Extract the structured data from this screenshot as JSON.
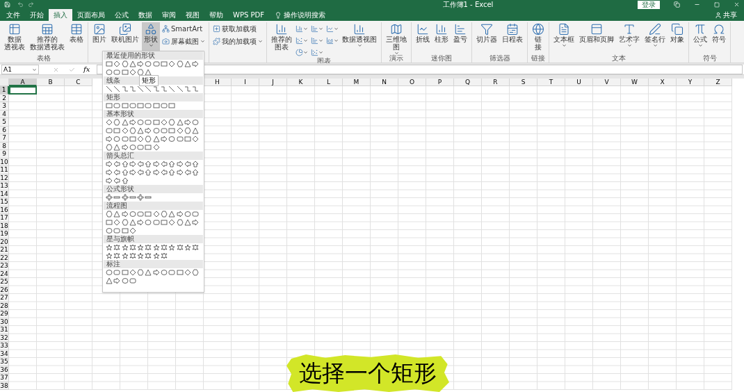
{
  "window": {
    "title": "工作簿1 - Excel",
    "login": "登录"
  },
  "tabs": [
    {
      "label": "文件",
      "selected": false
    },
    {
      "label": "开始",
      "selected": false
    },
    {
      "label": "插入",
      "selected": true
    },
    {
      "label": "页面布局",
      "selected": false
    },
    {
      "label": "公式",
      "selected": false
    },
    {
      "label": "数据",
      "selected": false
    },
    {
      "label": "审阅",
      "selected": false
    },
    {
      "label": "视图",
      "selected": false
    },
    {
      "label": "帮助",
      "selected": false
    },
    {
      "label": "WPS PDF",
      "selected": false
    }
  ],
  "tell_me": "操作说明搜索",
  "share": "共享",
  "ribbon_groups": [
    {
      "label": "表格",
      "items": [
        {
          "kind": "large",
          "lines": [
            "数据",
            "透视表"
          ],
          "selected": false,
          "has_menu": false
        },
        {
          "kind": "large",
          "lines": [
            "推荐的",
            "数据透视表"
          ],
          "selected": false,
          "has_menu": false
        },
        {
          "kind": "large",
          "lines": [
            "表格"
          ],
          "selected": false,
          "has_menu": false
        }
      ]
    },
    {
      "items": [
        {
          "kind": "large",
          "lines": [
            "图片"
          ],
          "selected": false,
          "has_menu": false
        },
        {
          "kind": "large",
          "lines": [
            "联机图片"
          ],
          "selected": false,
          "has_menu": false
        },
        {
          "kind": "large",
          "lines": [
            "形状"
          ],
          "selected": true,
          "has_menu": true
        },
        {
          "kind": "small",
          "lines": [
            "SmartArt"
          ],
          "selected": false,
          "has_menu": false
        },
        {
          "kind": "small",
          "lines": [
            "屏幕截图"
          ],
          "selected": false,
          "has_menu": true
        }
      ]
    },
    {
      "items": [
        {
          "kind": "small",
          "lines": [
            "获取加载项"
          ],
          "selected": false,
          "has_menu": false
        },
        {
          "kind": "small",
          "lines": [
            "我的加载项"
          ],
          "selected": false,
          "has_menu": true
        }
      ]
    },
    {
      "label": "图表",
      "items": [
        {
          "kind": "large",
          "lines": [
            "推荐的",
            "图表"
          ],
          "selected": false,
          "has_menu": false
        },
        {
          "kind": "icon",
          "selected": false,
          "has_menu": true
        },
        {
          "kind": "icon",
          "selected": false,
          "has_menu": true
        },
        {
          "kind": "icon",
          "selected": false,
          "has_menu": true
        },
        {
          "kind": "icon",
          "selected": false,
          "has_menu": true
        },
        {
          "kind": "icon",
          "selected": false,
          "has_menu": true
        },
        {
          "kind": "icon",
          "selected": false,
          "has_menu": true
        },
        {
          "kind": "icon",
          "selected": false,
          "has_menu": true
        },
        {
          "kind": "icon",
          "selected": false,
          "has_menu": true
        },
        {
          "kind": "large",
          "lines": [
            "数据透视图"
          ],
          "selected": false,
          "has_menu": true
        }
      ]
    },
    {
      "label": "演示",
      "items": [
        {
          "kind": "large",
          "lines": [
            "三维地",
            "图"
          ],
          "selected": false,
          "has_menu": true
        }
      ]
    },
    {
      "label": "迷你图",
      "items": [
        {
          "kind": "large",
          "lines": [
            "折线"
          ],
          "selected": false,
          "has_menu": false
        },
        {
          "kind": "large",
          "lines": [
            "柱形"
          ],
          "selected": false,
          "has_menu": false
        },
        {
          "kind": "large",
          "lines": [
            "盈亏"
          ],
          "selected": false,
          "has_menu": false
        }
      ]
    },
    {
      "label": "筛选器",
      "items": [
        {
          "kind": "large",
          "lines": [
            "切片器"
          ],
          "selected": false,
          "has_menu": false
        },
        {
          "kind": "large",
          "lines": [
            "日程表"
          ],
          "selected": false,
          "has_menu": false
        }
      ]
    },
    {
      "label": "链接",
      "items": [
        {
          "kind": "large",
          "lines": [
            "链",
            "接"
          ],
          "selected": false,
          "has_menu": false
        }
      ]
    },
    {
      "label": "文本",
      "items": [
        {
          "kind": "large",
          "lines": [
            "文本框"
          ],
          "selected": false,
          "has_menu": true
        },
        {
          "kind": "large",
          "lines": [
            "页眉和页脚"
          ],
          "selected": false,
          "has_menu": false
        },
        {
          "kind": "large",
          "lines": [
            "艺术字"
          ],
          "selected": false,
          "has_menu": true
        },
        {
          "kind": "large",
          "lines": [
            "签名行"
          ],
          "selected": false,
          "has_menu": true
        },
        {
          "kind": "large",
          "lines": [
            "对象"
          ],
          "selected": false,
          "has_menu": false
        }
      ]
    },
    {
      "label": "符号",
      "items": [
        {
          "kind": "large",
          "lines": [
            "公式"
          ],
          "selected": false,
          "has_menu": true
        },
        {
          "kind": "large",
          "lines": [
            "符号"
          ],
          "selected": false,
          "has_menu": false
        }
      ]
    }
  ],
  "formula_bar": {
    "name_box": "A1",
    "function_label": "fx"
  },
  "columns": [
    {
      "label": "A",
      "selected": true
    },
    {
      "label": "B",
      "selected": false
    },
    {
      "label": "C",
      "selected": false
    },
    {
      "label": "H",
      "selected": false
    },
    {
      "label": "I",
      "selected": false
    },
    {
      "label": "J",
      "selected": false
    },
    {
      "label": "K",
      "selected": false
    },
    {
      "label": "L",
      "selected": false
    },
    {
      "label": "M",
      "selected": false
    },
    {
      "label": "N",
      "selected": false
    },
    {
      "label": "O",
      "selected": false
    },
    {
      "label": "P",
      "selected": false
    },
    {
      "label": "Q",
      "selected": false
    },
    {
      "label": "R",
      "selected": false
    },
    {
      "label": "S",
      "selected": false
    },
    {
      "label": "T",
      "selected": false
    },
    {
      "label": "U",
      "selected": false
    },
    {
      "label": "V",
      "selected": false
    },
    {
      "label": "W",
      "selected": false
    },
    {
      "label": "X",
      "selected": false
    },
    {
      "label": "Y",
      "selected": false
    },
    {
      "label": "Z",
      "selected": false
    }
  ],
  "rows": [
    {
      "label": "1",
      "selected": true
    },
    {
      "label": "2",
      "selected": false
    },
    {
      "label": "3",
      "selected": false
    },
    {
      "label": "4",
      "selected": false
    },
    {
      "label": "5",
      "selected": false
    },
    {
      "label": "6",
      "selected": false
    },
    {
      "label": "7",
      "selected": false
    },
    {
      "label": "8",
      "selected": false
    },
    {
      "label": "9",
      "selected": false
    },
    {
      "label": "10",
      "selected": false
    },
    {
      "label": "11",
      "selected": false
    },
    {
      "label": "12",
      "selected": false
    },
    {
      "label": "13",
      "selected": false
    },
    {
      "label": "14",
      "selected": false
    },
    {
      "label": "15",
      "selected": false
    },
    {
      "label": "16",
      "selected": false
    },
    {
      "label": "17",
      "selected": false
    },
    {
      "label": "18",
      "selected": false
    },
    {
      "label": "19",
      "selected": false
    },
    {
      "label": "20",
      "selected": false
    },
    {
      "label": "21",
      "selected": false
    },
    {
      "label": "22",
      "selected": false
    },
    {
      "label": "23",
      "selected": false
    },
    {
      "label": "24",
      "selected": false
    },
    {
      "label": "25",
      "selected": false
    },
    {
      "label": "26",
      "selected": false
    },
    {
      "label": "27",
      "selected": false
    },
    {
      "label": "28",
      "selected": false
    },
    {
      "label": "29",
      "selected": false
    },
    {
      "label": "30",
      "selected": false
    },
    {
      "label": "31",
      "selected": false
    },
    {
      "label": "32",
      "selected": false
    },
    {
      "label": "33",
      "selected": false
    },
    {
      "label": "34",
      "selected": false
    },
    {
      "label": "35",
      "selected": false
    },
    {
      "label": "36",
      "selected": false
    },
    {
      "label": "37",
      "selected": false
    },
    {
      "label": "38",
      "selected": false
    }
  ],
  "shapes_menu": {
    "sections": [
      {
        "title": "最近使用的形状"
      },
      {
        "title": "线条"
      },
      {
        "title": "矩形"
      },
      {
        "title": "基本形状"
      },
      {
        "title": "箭头总汇"
      },
      {
        "title": "公式形状"
      },
      {
        "title": "流程图"
      },
      {
        "title": "星与旗帜"
      },
      {
        "title": "标注"
      }
    ],
    "tooltip": "矩形"
  },
  "caption": "选择一个矩形"
}
